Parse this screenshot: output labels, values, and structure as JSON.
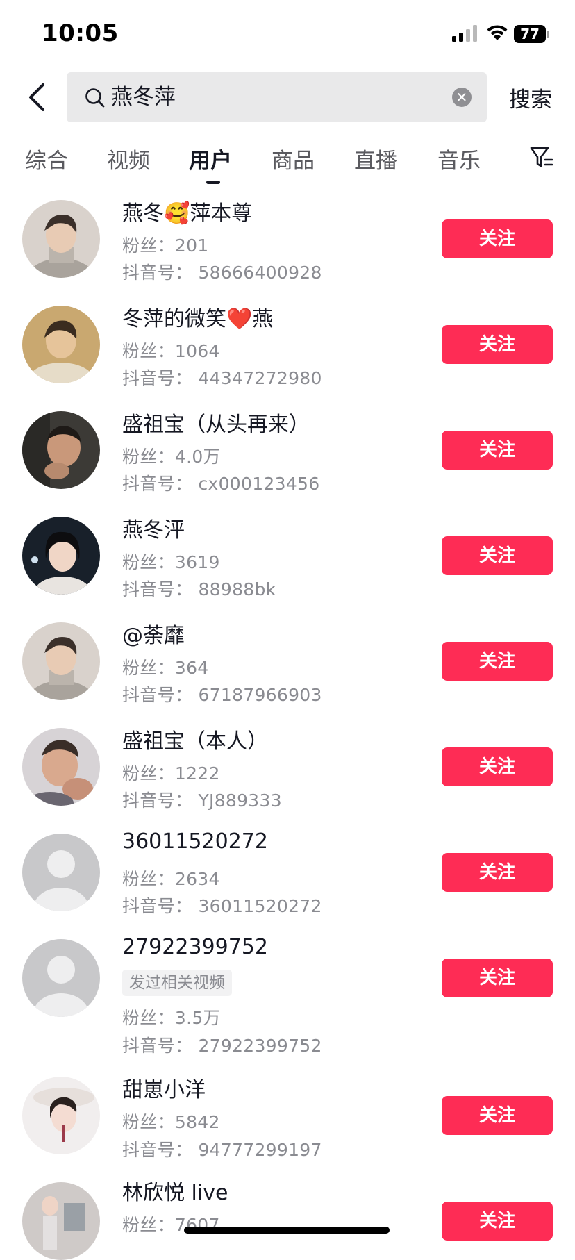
{
  "status_bar": {
    "time": "10:05",
    "battery": "77"
  },
  "search": {
    "query": "燕冬萍",
    "submit_label": "搜索"
  },
  "tabs": [
    {
      "label": "综合"
    },
    {
      "label": "视频"
    },
    {
      "label": "用户"
    },
    {
      "label": "商品"
    },
    {
      "label": "直播"
    },
    {
      "label": "音乐"
    }
  ],
  "active_tab": "用户",
  "users": [
    {
      "name": "燕冬",
      "emoji": "🥰",
      "name_suffix": "萍本尊",
      "fans": "粉丝：201",
      "douyin_id": "抖音号：  58666400928",
      "follow_label": "关注"
    },
    {
      "name": "冬萍的微笑",
      "emoji": "❤️",
      "name_suffix": "燕",
      "fans": "粉丝：1064",
      "douyin_id": "抖音号：  44347272980",
      "follow_label": "关注"
    },
    {
      "name": "盛祖宝（从头再来）",
      "fans": "粉丝：4.0万",
      "douyin_id": "抖音号：  cx000123456",
      "follow_label": "关注"
    },
    {
      "name": "燕冬泙",
      "fans": "粉丝：3619",
      "douyin_id": "抖音号：  88988bk",
      "follow_label": "关注"
    },
    {
      "name": "@荼靡",
      "fans": "粉丝：364",
      "douyin_id": "抖音号：  67187966903",
      "follow_label": "关注"
    },
    {
      "name": "盛祖宝（本人）",
      "fans": "粉丝：1222",
      "douyin_id": "抖音号：  YJ889333",
      "follow_label": "关注"
    },
    {
      "name": "36011520272",
      "fans": "粉丝：2634",
      "douyin_id": "抖音号：  36011520272",
      "follow_label": "关注"
    },
    {
      "name": "27922399752",
      "tag": "发过相关视频",
      "fans": "粉丝：3.5万",
      "douyin_id": "抖音号：  27922399752",
      "follow_label": "关注"
    },
    {
      "name": "甜崽小洋",
      "fans": "粉丝：5842",
      "douyin_id": "抖音号：  94777299197",
      "follow_label": "关注"
    },
    {
      "name": "林欣悦 live",
      "fans": "粉丝：7607",
      "follow_label": "关注"
    }
  ],
  "colors": {
    "accent": "#fe2c55",
    "text": "#161823",
    "secondary_text": "#8a8b91",
    "search_bg": "#e9e9ea"
  }
}
